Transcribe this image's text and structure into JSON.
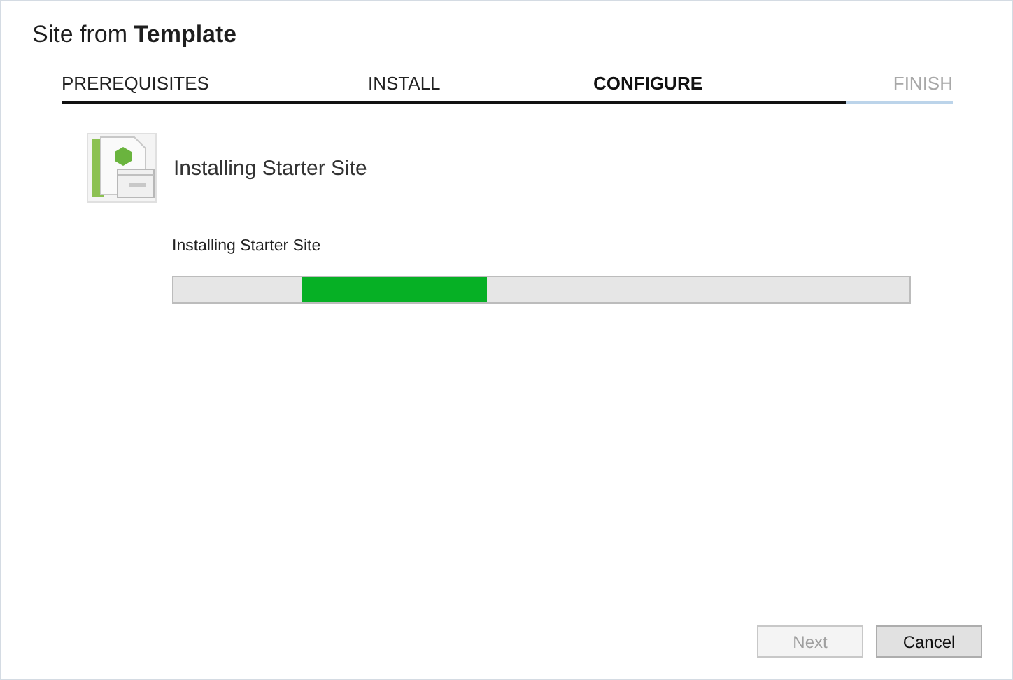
{
  "window": {
    "title": "Site from **Template**"
  },
  "steps": [
    {
      "label": "PREREQUISITES",
      "completed": true,
      "selected": false
    },
    {
      "label": "INSTALL",
      "completed": true,
      "selected": false
    },
    {
      "label": "CONFIGURE",
      "completed": true,
      "selected": true
    },
    {
      "label": "FINISH",
      "completed": false,
      "selected": false
    }
  ],
  "heading": "Installing Starter Site",
  "progress": {
    "label": "Installing Starter Site",
    "indeterminate": true
  },
  "buttons": [
    {
      "label": "Next",
      "disabled": true
    },
    {
      "label": "Cancel",
      "disabled": false
    }
  ]
}
